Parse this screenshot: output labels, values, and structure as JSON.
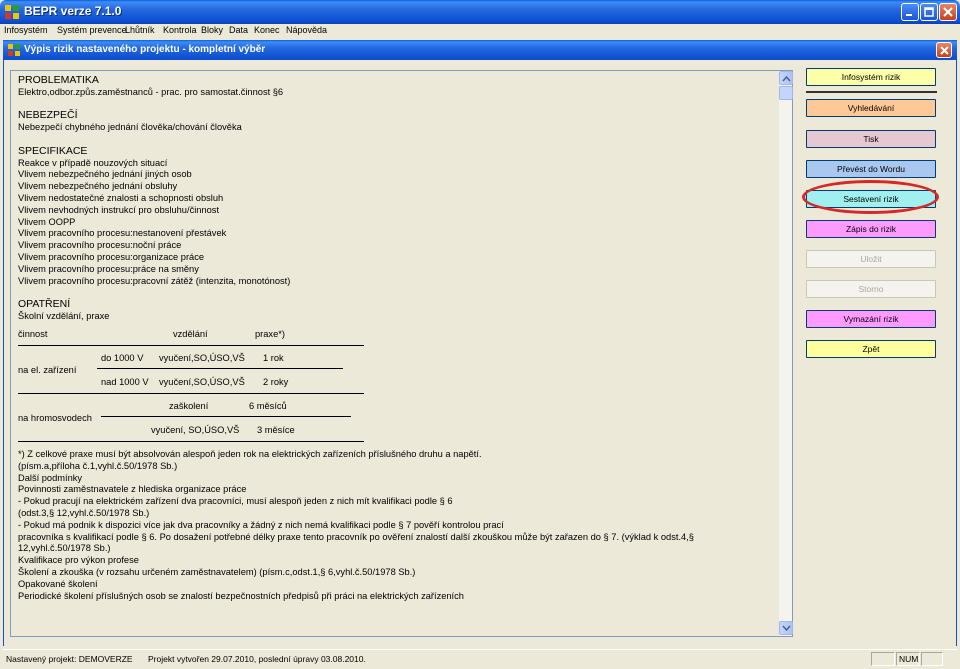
{
  "app": {
    "title": "BEPR verze 7.1.0"
  },
  "menu": [
    "Infosystém",
    "Systém prevence",
    "Lhůtník",
    "Kontrola",
    "Bloky",
    "Data",
    "Konec",
    "Nápověda"
  ],
  "mdi": {
    "title": "Výpis rizik nastaveného projektu - kompletní výběr"
  },
  "content": {
    "problematika_head": "PROBLEMATIKA",
    "problematika": "Elektro,odbor.způs.zaměstnanců - prac. pro samostat.činnost §6",
    "nebezpeci_head": "NEBEZPEČÍ",
    "nebezpeci": "Nebezpečí chybného jednání člověka/chování člověka",
    "specifikace_head": "SPECIFIKACE",
    "specifikace": [
      "Reakce v případě nouzových situací",
      "Vlivem nebezpečného jednání jiných osob",
      "Vlivem nebezpečného jednání obsluhy",
      "Vlivem nedostatečné znalosti a schopnosti obsluh",
      "Vlivem nevhodných instrukcí pro obsluhu/činnost",
      "Vlivem OOPP",
      "Vlivem pracovního procesu:nestanovení přestávek",
      "Vlivem pracovního procesu:noční práce",
      "Vlivem pracovního procesu:organizace práce",
      "Vlivem pracovního procesu:práce na směny",
      "Vlivem pracovního procesu:pracovní zátěž (intenzita, monotónost)"
    ],
    "opatreni_head": "OPATŘENÍ",
    "opatreni_sub": "Školní vzdělání, praxe",
    "table": {
      "col1": "činnost",
      "col2": "vzdělání",
      "col3": "praxe*)",
      "el_label": "na el. zařízení",
      "el_r1_a": "do 1000 V",
      "el_r1_b": "vyučení,SO,ÚSO,VŠ",
      "el_r1_c": "1 rok",
      "el_r2_a": "nad 1000 V",
      "el_r2_b": "vyučení,SO,ÚSO,VŠ",
      "el_r2_c": "2 roky",
      "hr_label": "na hromosvodech",
      "hr_r1_b": "zaškolení",
      "hr_r1_c": "6 měsíců",
      "hr_r2_b": "vyučení, SO,ÚSO,VŠ",
      "hr_r2_c": "3 měsíce"
    },
    "footnote1": "*) Z celkové praxe musí být absolvován alespoň jeden rok na elektrických zařízeních příslušného druhu a napětí.",
    "footnote2": "(písm.a,příloha č.1,vyhl.č.50/1978 Sb.)",
    "dalsi_head": "Další podmínky",
    "dalsi": [
      "Povinnosti zaměstnavatele z hlediska organizace práce",
      "- Pokud pracují na elektrickém zařízení dva pracovníci, musí alespoň jeden z nich mít kvalifikaci podle § 6",
      "(odst.3,§ 12,vyhl.č.50/1978 Sb.)",
      "- Pokud má podnik k dispozici více jak dva pracovníky a žádný z nich nemá kvalifikaci podle § 7 pověří kontrolou prací",
      "pracovníka s kvalifikací podle § 6. Po dosažení potřebné délky praxe tento pracovník po ověření znalostí další zkouškou může být zařazen do § 7.   (výklad k odst.4,§",
      "12,vyhl.č.50/1978 Sb.)"
    ],
    "kval_head": "Kvalifikace pro výkon profese",
    "kval": "Školení a zkouška (v rozsahu určeném zaměstnavatelem)   (písm.c,odst.1,§ 6,vyhl.č.50/1978 Sb.)",
    "opak_head": "Opakované školení",
    "opak_cut": "Periodické školení příslušných osob se znalostí bezpečnostních předpisů při práci na elektrických zařízeních"
  },
  "buttons": [
    {
      "label": "Infosystém rizik",
      "color": "#ffffa8",
      "enabled": true
    },
    {
      "label": "Vyhledávání",
      "color": "#ffc896",
      "enabled": true
    },
    {
      "label": "Tisk",
      "color": "#e6c8d2",
      "enabled": true
    },
    {
      "label": "Převést do Wordu",
      "color": "#a8c8f0",
      "enabled": true
    },
    {
      "label": "Sestavení rizik",
      "color": "#a0f0f0",
      "enabled": true
    },
    {
      "label": "Zápis do rizik",
      "color": "#ff9bff",
      "enabled": true
    },
    {
      "label": "Uložit",
      "color": "#f4f3ee",
      "enabled": false
    },
    {
      "label": "Storno",
      "color": "#f4f3ee",
      "enabled": false
    },
    {
      "label": "Vymazání rizik",
      "color": "#ff9bff",
      "enabled": true
    },
    {
      "label": "Zpět",
      "color": "#ffff9b",
      "enabled": true
    }
  ],
  "status": {
    "project": "Nastavený projekt: DEMOVERZE",
    "created": "Projekt vytvořen 29.07.2010, poslední úpravy 03.08.2010.",
    "num": "NUM"
  }
}
